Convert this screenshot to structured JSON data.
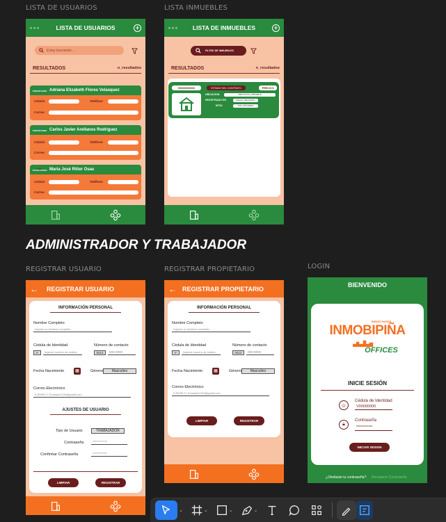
{
  "labels": {
    "lista_usuarios": "LISTA DE USUARIOS",
    "lista_inmuebles": "LISTA INMUEBLES",
    "registrar_usuario": "REGISTRAR USUARIO",
    "registrar_propietario": "REGISTRAR PROPIETARIO",
    "login": "LOGIN"
  },
  "section_title": "ADMINISTRADOR Y TRABAJADOR",
  "usuarios": {
    "title": "LISTA DE USUARIOS",
    "search_placeholder": "Estoy buscando...",
    "resultados": "RESULTADOS",
    "n_resultados": "n_resultados",
    "cards": [
      {
        "role": "PROPIETARIO",
        "name": "Adriana Elizabeth Flores Velasquez"
      },
      {
        "role": "PROPIETARIO",
        "name": "Carlos Javier Arellanos Rodriguez"
      },
      {
        "role": "TRABAJADOR",
        "name": "Maria José Ritier Osas"
      }
    ],
    "cedula": "Cédula",
    "telefono": "Teléfono",
    "correo": "Correo"
  },
  "inmuebles": {
    "title": "LISTA DE INMUEBLES",
    "filtro": "FILTRO DE INMUEBLES",
    "resultados": "RESULTADOS",
    "n_resultados": "n_resultados",
    "card": {
      "code": "000000000000",
      "estado": "ESTADO DEL CONTRATO",
      "precio": "PRECIO $",
      "ubicacion": "UBICACION",
      "ubicacion_val": "UBICACION_INMUEBLE",
      "registrado": "REGISTRADO EN",
      "registrado_val": "FECHA_REGISTRO",
      "mts2": "MTS2",
      "mts2_val": "TAM_INMUEBLE"
    }
  },
  "reg_usuario": {
    "title": "REGISTRAR USUARIO",
    "info": "INFORMACIÓN PERSONAL",
    "nombre": "Nombre Completo",
    "nombre_ph": "Ingrese su Nombre completo...",
    "cedula": "Cédula de Identidad",
    "cedula_prefix": "V-",
    "cedula_ph": "Ingrese numero de cedula",
    "contacto": "Número de contacto",
    "contacto_prefix": "0412",
    "contacto_ph": "000-0000",
    "fecha": "Fecha Nacimiento",
    "genero": "Género",
    "genero_val": "Masculino",
    "correo": "Correo Electrónico",
    "correo_ph": "EJEMPLO: Example1234@gmail.com",
    "ajustes": "AJUSTES DE USUARIO",
    "tipo": "Tipo de Usuario",
    "tipo_val": "TRABAJADOR",
    "contrasena": "Contraseña",
    "confirmar": "Confirmar Contraseña",
    "pwd_mask": "************",
    "limpiar": "LIMPIAR",
    "registrar": "REGISTRAR"
  },
  "reg_propietario": {
    "title": "REGISTRAR PROPIETARIO",
    "info": "INFORMACIÓN PERSONAL",
    "nombre": "Nombre Completo",
    "nombre_ph": "Ingrese su Nombre completo...",
    "cedula": "Cédula de Identidad",
    "cedula_prefix": "V-",
    "cedula_ph": "Ingrese numero de cedula",
    "contacto": "Número de contacto",
    "contacto_prefix": "0412",
    "contacto_ph": "000-0000",
    "fecha": "Fecha Nacimiento",
    "genero": "Género",
    "genero_val": "Masculino",
    "correo": "Correo Electrónico",
    "correo_ph": "EJEMPLO: Example1234@gmail.com",
    "limpiar": "LIMPIAR",
    "registrar": "REGISTRAR"
  },
  "login": {
    "title": "BIENVENIDO",
    "logo_small": "BIENES RAÍCES",
    "logo_big": "INMOBIPIÑA",
    "logo_sub": "OFFICES",
    "inicie": "INICIE SESIÓN",
    "cedula": "Cédula de Identidad",
    "cedula_val": "V00000000",
    "contrasena": "Contraseña",
    "pwd_mask": "************",
    "btn": "INICIAR SESION",
    "olvido": "¿Olvidaste tu contraseña?",
    "recuperar": "Recuperar Contraseña"
  },
  "colors": {
    "green": "#2a8a3d",
    "orange": "#f37021",
    "peach": "#f7c3a4",
    "maroon": "#6a1d1d"
  }
}
